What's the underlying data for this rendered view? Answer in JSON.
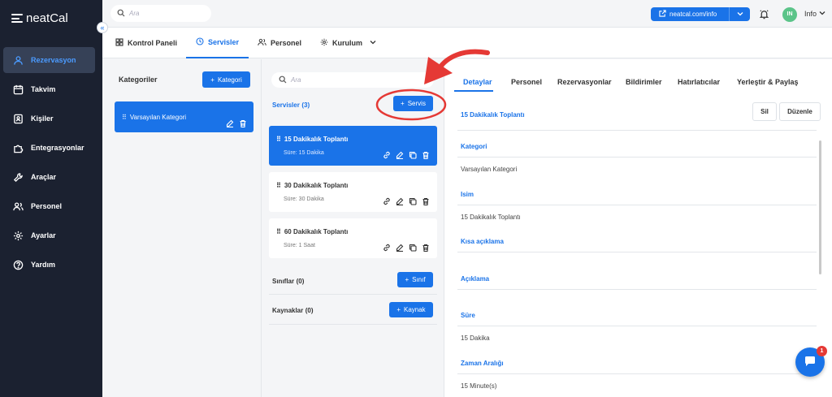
{
  "app": {
    "logo": "neatCal"
  },
  "sidebar": {
    "items": [
      {
        "label": "Rezervasyon",
        "icon": "user-icon",
        "active": true
      },
      {
        "label": "Takvim",
        "icon": "calendar-icon"
      },
      {
        "label": "Kişiler",
        "icon": "contacts-icon"
      },
      {
        "label": "Entegrasyonlar",
        "icon": "puzzle-icon"
      },
      {
        "label": "Araçlar",
        "icon": "tools-icon"
      },
      {
        "label": "Personel",
        "icon": "users-icon"
      },
      {
        "label": "Ayarlar",
        "icon": "gear-icon"
      },
      {
        "label": "Yardım",
        "icon": "help-icon"
      }
    ]
  },
  "topbar": {
    "search_placeholder": "Ara",
    "link_label": "neatcal.com/info",
    "avatar_initials": "IN",
    "user_name": "Info"
  },
  "module_tabs": [
    {
      "label": "Kontrol Paneli",
      "icon": "grid-icon"
    },
    {
      "label": "Servisler",
      "icon": "clock-icon",
      "active": true
    },
    {
      "label": "Personel",
      "icon": "users-icon"
    },
    {
      "label": "Kurulum",
      "icon": "gear-icon"
    }
  ],
  "categories": {
    "title": "Kategoriler",
    "add_label": "Kategori",
    "items": [
      {
        "name": "Varsayılan Kategori"
      }
    ]
  },
  "services": {
    "search_placeholder": "Ara",
    "title": "Servisler",
    "count": "(3)",
    "add_label": "Servis",
    "items": [
      {
        "name": "15 Dakikalık Toplantı",
        "duration": "Süre: 15 Dakika"
      },
      {
        "name": "30 Dakikalık Toplantı",
        "duration": "Süre: 30 Dakika"
      },
      {
        "name": "60 Dakikalık Toplantı",
        "duration": "Süre: 1 Saat"
      }
    ],
    "classes_title": "Sınıflar",
    "classes_count": "(0)",
    "classes_add": "Sınıf",
    "resources_title": "Kaynaklar",
    "resources_count": "(0)",
    "resources_add": "Kaynak"
  },
  "details": {
    "tabs": [
      "Detaylar",
      "Personel",
      "Rezervasyonlar",
      "Bildirimler",
      "Hatırlatıcılar",
      "Yerleştir & Paylaş"
    ],
    "title": "15 Dakikalık Toplantı",
    "delete_label": "Sil",
    "edit_label": "Düzenle",
    "fields": {
      "category_label": "Kategori",
      "category_value": "Varsayılan Kategori",
      "name_label": "Isim",
      "name_value": "15 Dakikalık Toplantı",
      "short_desc_label": "Kısa açıklama",
      "desc_label": "Açıklama",
      "duration_label": "Süre",
      "duration_value": "15 Dakika",
      "interval_label": "Zaman Aralığı",
      "interval_value": "15 Minute(s)"
    }
  },
  "chat": {
    "badge": "1"
  },
  "colors": {
    "accent": "#1a73e8",
    "sidebar": "#1b2130",
    "annotation": "#e53935"
  }
}
